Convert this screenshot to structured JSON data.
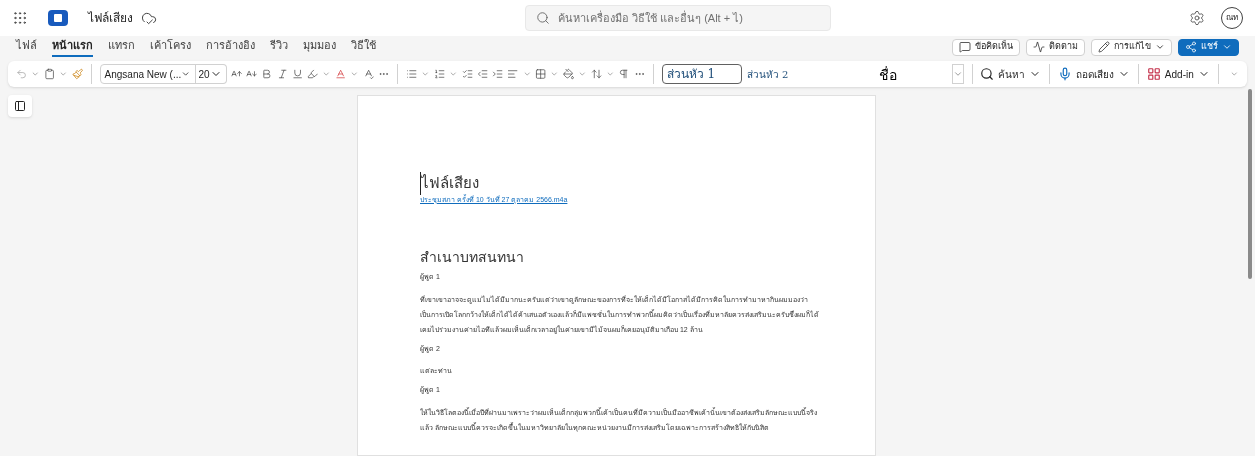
{
  "app": {
    "file_name": "ไฟล์เสียง",
    "search": {
      "placeholder": "ค้นหาเครื่องมือ วิธีใช้ และอื่นๆ (Alt + ไ)"
    },
    "avatar": "ณท"
  },
  "tabs": [
    {
      "label": "ไฟล์",
      "selected": false
    },
    {
      "label": "หน้าแรก",
      "selected": true
    },
    {
      "label": "แทรก",
      "selected": false
    },
    {
      "label": "เค้าโครง",
      "selected": false
    },
    {
      "label": "การอ้างอิง",
      "selected": false
    },
    {
      "label": "รีวิว",
      "selected": false
    },
    {
      "label": "มุมมอง",
      "selected": false
    },
    {
      "label": "วิธีใช้",
      "selected": false
    }
  ],
  "actions": [
    {
      "label": "ข้อคิดเห็น",
      "kind": "comments"
    },
    {
      "label": "ติดตาม",
      "kind": "catchup"
    },
    {
      "label": "การแก้ไข",
      "kind": "editing"
    },
    {
      "label": "แชร์",
      "kind": "share"
    }
  ],
  "ribbon": {
    "font": "Angsana New (...",
    "size": "20",
    "styles": [
      {
        "label": "ส่วนหัว 1",
        "selected": true
      },
      {
        "label": "ส่วนหัว 2",
        "selected": false
      },
      {
        "label": "ชื่อ",
        "selected": false
      }
    ],
    "find": "ค้นหา",
    "dictate": "ถอดเสียง",
    "addin": "Add-in"
  },
  "document": {
    "title": "ไฟล์เสียง",
    "link": "ประชุมสภา ครั้งที่ 10 วันที่ 27 ตุลาคม 2566.m4a",
    "heading": "สำเนาบทสนทนา",
    "blocks": [
      {
        "kind": "speaker",
        "text": "ผู้พูด 1"
      },
      {
        "kind": "para",
        "text": "ที่เขาเขาอาจจะดูแม่ไม่ได้มีมากนะครับแต่ว่าเขาดูลักษณะของการที่จะให้เด็กได้มีโอกาสได้มีการคิดในการทำมาหากินผมมองว่าเป็นการเปิดโลกกว้างให้เด็กได้ได้ค้าเสนอตัวเองแล้วก็มีแพชชั่นในการทำพวกนี้ผมคิดว่าเป็นเรื่องที่มหาลัยควรส่งเสริมนะครับซึ่งผมก็ได้เคยไปร่วมงานค่ายไอทีแล้วผมเห็นเด็กเวลาอยู่ในค่ายเขามีไม้จนผมก็เคยอนุมัติมาเกือบ 12 ล้าน"
      },
      {
        "kind": "speaker",
        "text": "ผู้พูด 2"
      },
      {
        "kind": "para",
        "text": "แต่ละท่าน"
      },
      {
        "kind": "speaker",
        "text": "ผู้พูด 1"
      },
      {
        "kind": "para",
        "text": "ให้ในวิธีโลตองนี้เมื่อปีที่ผ่านมาเพราะว่าผมเห็นเด็กกลุ่มพวกนี้เค้าเป็นคนที่มีความเป็นมืออาชีพเค้านั้นเขาต้องส่งเสริมลักษณะแบบนี้จริงแล้ว ลักษณะแบบนี้ควรจะเกิดขึ้นในมหาวิทยาลัยในทุกคณะหน่วยงานมีการส่งเสริมโดยเฉพาะการสร้างสิทธิให้กับนิสิต"
      }
    ]
  }
}
